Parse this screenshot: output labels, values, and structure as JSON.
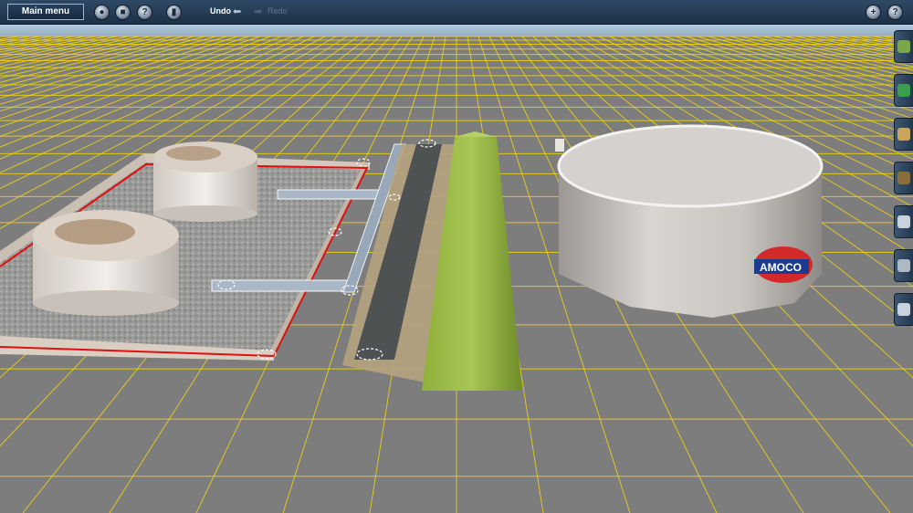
{
  "toolbar": {
    "main_menu_label": "Main menu",
    "undo_label": "Undo",
    "redo_label": "Redo",
    "left_buttons": [
      "camera-icon",
      "save-icon",
      "info-icon",
      "delete-icon"
    ],
    "right_buttons": [
      "add-icon",
      "help-icon"
    ]
  },
  "sidebar": {
    "tools": [
      "terrain-paint-icon",
      "trees-icon",
      "objects-icon",
      "track-icon",
      "tools-icon",
      "layers-icon",
      "settings-icon"
    ]
  },
  "scene": {
    "sign_text": "AMOCO",
    "colors": {
      "grid_line": "#ffe000",
      "ground": "#7d7d7d",
      "sky": "#a9c4dc",
      "bund_border": "#e01010"
    }
  }
}
